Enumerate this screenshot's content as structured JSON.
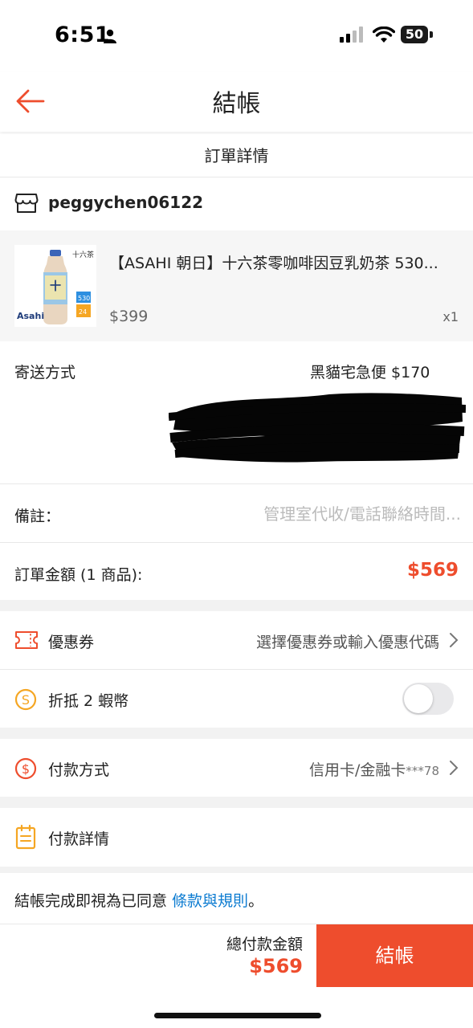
{
  "status_bar": {
    "time": "6:51",
    "battery": "50"
  },
  "header": {
    "title": "結帳"
  },
  "order": {
    "section_title": "訂單詳情",
    "shop_name": "peggychen06122",
    "product": {
      "name": "【ASAHI 朝日】十六茶零咖啡因豆乳奶茶 530...",
      "price": "$399",
      "qty": "x1",
      "image_label": "十六茶",
      "badge_top": "530",
      "badge_bottom": "24"
    }
  },
  "shipping": {
    "label": "寄送方式",
    "value": "黑貓宅急便 $170"
  },
  "note": {
    "label": "備註：",
    "placeholder": "管理室代收/電話聯絡時間..."
  },
  "order_total": {
    "label": "訂單金額 (1 商品):",
    "value": "$569"
  },
  "coupon": {
    "label": "優惠券",
    "value": "選擇優惠券或輸入優惠代碼"
  },
  "coins": {
    "label": "折抵 2 蝦幣",
    "enabled": false
  },
  "payment": {
    "label": "付款方式",
    "value": "信用卡/金融卡",
    "card_suffix": "***78"
  },
  "payment_detail": {
    "label": "付款詳情"
  },
  "agreement": {
    "text": "結帳完成即視為已同意 ",
    "link": "條款與規則",
    "suffix": "。"
  },
  "footer": {
    "total_label": "總付款金額",
    "total_value": "$569",
    "checkout_label": "結帳"
  },
  "colors": {
    "accent": "#ee4d2d",
    "link": "#0b7bd1"
  }
}
